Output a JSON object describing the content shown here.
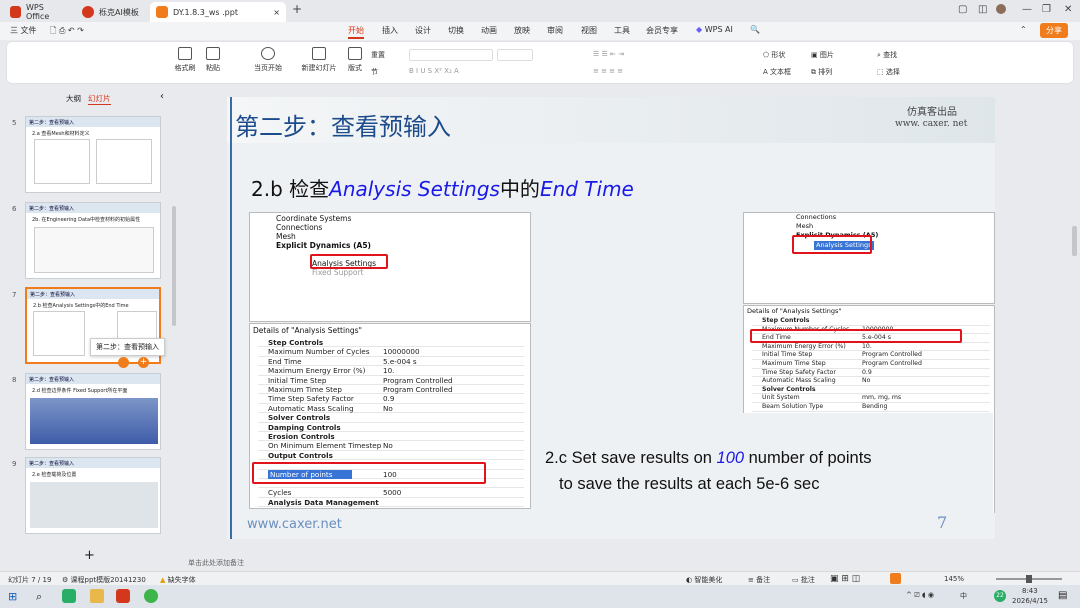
{
  "tabs": [
    {
      "label": "WPS Office",
      "color": "#d4381c"
    },
    {
      "label": "栎克AI模板",
      "color": "#d4381c"
    },
    {
      "label": "DY.1.8.3_ws .ppt",
      "color": "#f07c1b"
    }
  ],
  "titlebar": {
    "plus": "+"
  },
  "menu": {
    "file": "三 文件",
    "items": [
      "开始",
      "插入",
      "设计",
      "切换",
      "动画",
      "放映",
      "审阅",
      "视图",
      "工具",
      "会员专享"
    ],
    "active": "开始",
    "wpsai": "WPS AI",
    "share": "分享"
  },
  "ribbon": {
    "format_painter": "格式刷",
    "paste": "粘贴",
    "start_from": "当页开始",
    "new_slide": "新建幻灯片",
    "layout": "版式",
    "reset": "重置",
    "section": "节",
    "shape": "形状",
    "picture": "图片",
    "textbox": "文本框",
    "arrange": "排列",
    "find": "查找",
    "select": "选择"
  },
  "side": {
    "outline": "大纲",
    "slides": "幻灯片",
    "add": "+",
    "thumbs": [
      {
        "num": "5",
        "head": "第二步：查看预输入",
        "text": "2.a 查看Mesh和材料定义"
      },
      {
        "num": "6",
        "head": "第二步：查看预输入",
        "text": "2b. 在Engineering Data中检查材料的初始属性"
      },
      {
        "num": "7",
        "head": "第二步：查看预输入",
        "text": "2.b 检查Analysis Settings中的End Time"
      },
      {
        "num": "8",
        "head": "第二步：查看预输入",
        "text": "2.d 检查边界条件 Fixed Support所在平面"
      },
      {
        "num": "9",
        "head": "第二步：查看预输入",
        "text": "2.e 检查载荷及位置"
      }
    ],
    "tooltip": "第二步：查看预输入"
  },
  "slide": {
    "title": "第二步：查看预输入",
    "brand_cn": "仿真客出品",
    "brand_url": "www. caxer. net",
    "heading_pre": "2.b  检查",
    "heading_em1": "Analysis Settings",
    "heading_mid": "中的",
    "heading_em2": "End Time",
    "footer_url": "www.caxer.net",
    "page_num": "7",
    "caption_pre": "2.c Set save results on ",
    "caption_em": "100",
    "caption_post": " number of points",
    "caption_line2": "to save the results at each 5e-6 sec",
    "tree_left": [
      "Coordinate Systems",
      "Connections",
      "Mesh",
      "Explicit Dynamics (A5)",
      "Analysis Settings",
      "Fixed Support"
    ],
    "tree_right": [
      "Connections",
      "Mesh",
      "Explicit Dynamics (A5)",
      "Analysis Settings"
    ],
    "details_title": "Details of \"Analysis Settings\"",
    "left_rows": [
      {
        "k": "Step Controls",
        "v": "",
        "sec": true
      },
      {
        "k": "Maximum Number of Cycles",
        "v": "10000000"
      },
      {
        "k": "End Time",
        "v": "5.e-004 s"
      },
      {
        "k": "Maximum Energy Error (%)",
        "v": "10."
      },
      {
        "k": "Initial Time Step",
        "v": "Program Controlled"
      },
      {
        "k": "Maximum Time Step",
        "v": "Program Controlled"
      },
      {
        "k": "Time Step Safety Factor",
        "v": "0.9"
      },
      {
        "k": "Automatic Mass Scaling",
        "v": "No"
      },
      {
        "k": "Solver Controls",
        "v": "",
        "sec": true
      },
      {
        "k": "Damping Controls",
        "v": "",
        "sec": true
      },
      {
        "k": "Erosion Controls",
        "v": "",
        "sec": true
      },
      {
        "k": "On Minimum Element Timestep",
        "v": "No"
      },
      {
        "k": "Output Controls",
        "v": "",
        "sec": true
      },
      {
        "k": "",
        "v": ""
      },
      {
        "k": "Number of points",
        "v": "100"
      },
      {
        "k": "",
        "v": ""
      },
      {
        "k": "Cycles",
        "v": "5000"
      },
      {
        "k": "Analysis Data Management",
        "v": "",
        "sec": true
      }
    ],
    "right_rows": [
      {
        "k": "Step Controls",
        "v": "",
        "sec": true
      },
      {
        "k": "Maximum Number of Cycles",
        "v": "10000000"
      },
      {
        "k": "End Time",
        "v": "5.e-004 s"
      },
      {
        "k": "Maximum Energy Error (%)",
        "v": "10."
      },
      {
        "k": "Initial Time Step",
        "v": "Program Controlled"
      },
      {
        "k": "Maximum Time Step",
        "v": "Program Controlled"
      },
      {
        "k": "Time Step Safety Factor",
        "v": "0.9"
      },
      {
        "k": "Automatic Mass Scaling",
        "v": "No"
      },
      {
        "k": "Solver Controls",
        "v": "",
        "sec": true
      },
      {
        "k": "Unit System",
        "v": "mm, mg, ms"
      },
      {
        "k": "Beam Solution Type",
        "v": "Bending"
      }
    ]
  },
  "notes": "单击此处添加备注",
  "status": {
    "slide_count": "幻灯片 7 / 19",
    "template": "课程ppt模版20141230",
    "missing_font": "缺失字体",
    "beautify": "智能美化",
    "notes": "备注",
    "comments": "批注",
    "zoom": "145%"
  },
  "taskbar": {
    "time": "8:43",
    "date": "2026/4/15",
    "ime": "中",
    "badge": "22"
  }
}
